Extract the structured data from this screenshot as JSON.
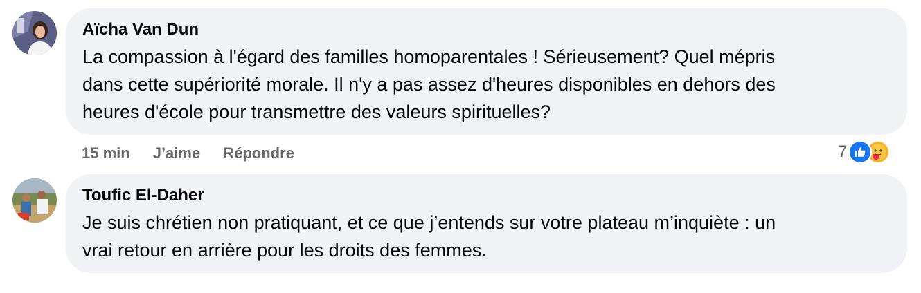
{
  "comments": [
    {
      "author": "Aïcha Van Dun",
      "text": "La compassion à l'égard des familles homoparentales ! Sérieusement? Quel mépris\ndans cette supériorité morale. Il n'y a pas assez d'heures disponibles en dehors des\nheures d'école pour transmettre des valeurs spirituelles?",
      "time": "15 min",
      "like_label": "J’aime",
      "reply_label": "Répondre",
      "reaction_count": "7",
      "reactions": [
        "like-icon",
        "care-icon"
      ]
    },
    {
      "author": "Toufic El-Daher",
      "text": "Je suis chrétien non pratiquant, et ce que j’entends sur votre plateau m’inquiète : un\nvrai retour en arrière pour les droits des femmes."
    }
  ],
  "colors": {
    "bubble": "#f0f2f5",
    "text": "#050505",
    "secondary": "#65676b",
    "like": "#1877f2",
    "care": "#f7b125"
  }
}
